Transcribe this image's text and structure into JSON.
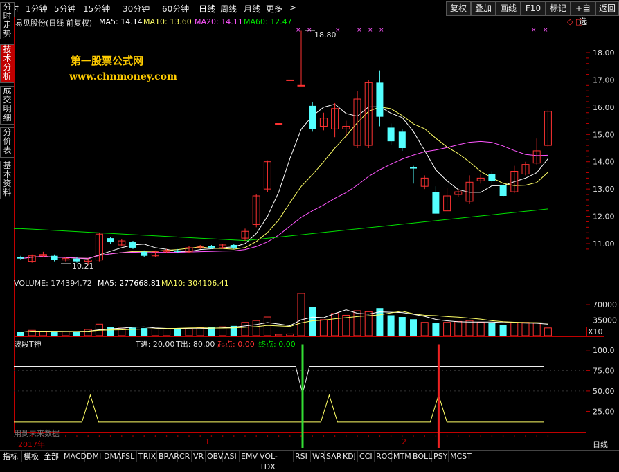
{
  "toolbar": {
    "periods": [
      "分时",
      "1分钟",
      "5分钟",
      "15分钟",
      "30分钟",
      "60分钟",
      "日线",
      "周线",
      "月线",
      "更多"
    ],
    "more_arrow": ">",
    "right_buttons": [
      "复权",
      "叠加",
      "画线",
      "F10",
      "标记",
      "+自选",
      "返回"
    ]
  },
  "side_tabs": [
    "分时走势",
    "技术分析",
    "成交明细",
    "分价表",
    "基本资料"
  ],
  "header": {
    "title": "易见股份(日线 前复权)",
    "ma5": "MA5: 14.14",
    "ma10": "MA10: 13.60",
    "ma20": "MA20: 14.11",
    "ma60": "MA60: 12.47"
  },
  "watermark": {
    "line1": "第一股票公式网",
    "line2": "www.chnmoney.com"
  },
  "price_axis": [
    "18.00",
    "17.00",
    "16.00",
    "15.00",
    "14.00",
    "13.00",
    "12.00",
    "11.00"
  ],
  "annotations": {
    "high": "18.80",
    "low": "10.21"
  },
  "volume_header": {
    "label": "VOLUME: 174394.72",
    "ma5": "MA5: 277668.81",
    "ma10": "MA10: 304106.41"
  },
  "volume_axis": [
    "70000",
    "35000"
  ],
  "volume_unit": "X10",
  "indicator_header": {
    "name": "波段T神",
    "t_in": "T进: 20.00",
    "t_out": "T出: 80.00",
    "start": "起点: 0.00",
    "end": "终点: 0.00"
  },
  "indicator_axis": [
    "100.0",
    "75.00",
    "50.00",
    "25.00"
  ],
  "indicator_note": "用到未来数据",
  "time_axis": {
    "year": "2017年",
    "m1": "1",
    "m2": "2"
  },
  "period_label": "日线",
  "bottom_tabs": [
    "指标",
    "模板",
    "全部",
    "MACD",
    "DMI",
    "DMA",
    "FSL",
    "TRIX",
    "BRAR",
    "CR",
    "VR",
    "OBV",
    "ASI",
    "EMV",
    "VOL-TDX",
    "RSI",
    "WR",
    "SAR",
    "KDJ",
    "CCI",
    "ROC",
    "MTM",
    "BOLL",
    "PSY",
    "MCST"
  ],
  "colors": {
    "up": "#ff3232",
    "down": "#54ffff",
    "ma5": "#ffffff",
    "ma10": "#ffff66",
    "ma20": "#ff55ff",
    "ma60": "#00e000",
    "axis": "#c00000",
    "watermark": "#ffcc00"
  },
  "chart_data": {
    "type": "candlestick",
    "ylim": [
      10.0,
      18.8
    ],
    "candles": [
      {
        "o": 10.5,
        "c": 10.45,
        "h": 10.55,
        "l": 10.4
      },
      {
        "o": 10.35,
        "c": 10.55,
        "h": 10.6,
        "l": 10.3
      },
      {
        "o": 10.55,
        "c": 10.6,
        "h": 10.7,
        "l": 10.5
      },
      {
        "o": 10.55,
        "c": 10.4,
        "h": 10.6,
        "l": 10.35
      },
      {
        "o": 10.4,
        "c": 10.45,
        "h": 10.5,
        "l": 10.35
      },
      {
        "o": 10.45,
        "c": 10.35,
        "h": 10.5,
        "l": 10.3
      },
      {
        "o": 10.35,
        "c": 10.4,
        "h": 10.45,
        "l": 10.21
      },
      {
        "o": 10.4,
        "c": 11.35,
        "h": 11.4,
        "l": 10.35
      },
      {
        "o": 11.2,
        "c": 11.05,
        "h": 11.25,
        "l": 11.0
      },
      {
        "o": 10.95,
        "c": 11.1,
        "h": 11.15,
        "l": 10.9
      },
      {
        "o": 11.05,
        "c": 10.85,
        "h": 11.1,
        "l": 10.8
      },
      {
        "o": 10.7,
        "c": 10.55,
        "h": 10.75,
        "l": 10.5
      },
      {
        "o": 10.55,
        "c": 10.7,
        "h": 10.75,
        "l": 10.5
      },
      {
        "o": 10.7,
        "c": 10.75,
        "h": 10.8,
        "l": 10.65
      },
      {
        "o": 10.75,
        "c": 10.7,
        "h": 10.8,
        "l": 10.65
      },
      {
        "o": 10.7,
        "c": 10.85,
        "h": 10.9,
        "l": 10.65
      },
      {
        "o": 10.85,
        "c": 10.9,
        "h": 10.95,
        "l": 10.8
      },
      {
        "o": 10.9,
        "c": 10.85,
        "h": 10.95,
        "l": 10.8
      },
      {
        "o": 10.85,
        "c": 10.95,
        "h": 11.0,
        "l": 10.8
      },
      {
        "o": 10.95,
        "c": 10.85,
        "h": 11.0,
        "l": 10.8
      },
      {
        "o": 11.2,
        "c": 11.45,
        "h": 11.55,
        "l": 11.1
      },
      {
        "o": 11.7,
        "c": 12.75,
        "h": 12.8,
        "l": 11.6
      },
      {
        "o": 13.0,
        "c": 14.0,
        "h": 14.05,
        "l": 12.9
      },
      {
        "o": 15.4,
        "c": 15.4,
        "h": 15.4,
        "l": 15.4
      },
      {
        "o": 17.0,
        "c": 17.0,
        "h": 17.0,
        "l": 17.0
      },
      {
        "o": 16.8,
        "c": 16.8,
        "h": 18.8,
        "l": 16.8
      },
      {
        "o": 16.05,
        "c": 15.2,
        "h": 16.2,
        "l": 15.1
      },
      {
        "o": 15.3,
        "c": 15.6,
        "h": 15.8,
        "l": 15.15
      },
      {
        "o": 15.2,
        "c": 15.95,
        "h": 16.15,
        "l": 14.9
      },
      {
        "o": 15.2,
        "c": 15.3,
        "h": 15.5,
        "l": 14.9
      },
      {
        "o": 14.6,
        "c": 16.3,
        "h": 16.6,
        "l": 14.5
      },
      {
        "o": 14.6,
        "c": 16.9,
        "h": 17.0,
        "l": 14.5
      },
      {
        "o": 16.9,
        "c": 15.65,
        "h": 17.35,
        "l": 15.3
      },
      {
        "o": 15.25,
        "c": 14.75,
        "h": 15.4,
        "l": 14.6
      },
      {
        "o": 15.1,
        "c": 14.5,
        "h": 15.2,
        "l": 14.4
      },
      {
        "o": 13.8,
        "c": 13.75,
        "h": 13.85,
        "l": 13.2
      },
      {
        "o": 13.1,
        "c": 13.4,
        "h": 13.5,
        "l": 13.0
      },
      {
        "o": 12.9,
        "c": 12.1,
        "h": 13.1,
        "l": 12.1
      },
      {
        "o": 12.2,
        "c": 12.75,
        "h": 13.05,
        "l": 12.2
      },
      {
        "o": 12.8,
        "c": 12.9,
        "h": 13.0,
        "l": 12.7
      },
      {
        "o": 12.55,
        "c": 13.25,
        "h": 13.5,
        "l": 12.45
      },
      {
        "o": 13.3,
        "c": 13.4,
        "h": 13.55,
        "l": 13.2
      },
      {
        "o": 13.55,
        "c": 13.3,
        "h": 13.65,
        "l": 13.2
      },
      {
        "o": 13.15,
        "c": 12.75,
        "h": 13.2,
        "l": 12.7
      },
      {
        "o": 12.9,
        "c": 13.65,
        "h": 13.85,
        "l": 12.85
      },
      {
        "o": 13.55,
        "c": 13.9,
        "h": 14.0,
        "l": 13.5
      },
      {
        "o": 13.95,
        "c": 14.4,
        "h": 14.85,
        "l": 13.9
      },
      {
        "o": 14.6,
        "c": 15.85,
        "h": 15.9,
        "l": 14.55
      }
    ],
    "volume_ylim": [
      0,
      95000
    ],
    "volumes": [
      8000,
      12000,
      10000,
      9000,
      9000,
      8000,
      14000,
      26000,
      20000,
      17000,
      18000,
      17000,
      15000,
      15000,
      15000,
      16000,
      18000,
      20000,
      20000,
      22000,
      30000,
      34000,
      42000,
      3000,
      4000,
      95000,
      64000,
      36000,
      50000,
      46000,
      56000,
      54000,
      62000,
      46000,
      42000,
      37000,
      30000,
      28000,
      30000,
      32000,
      34000,
      30000,
      28000,
      24000,
      30000,
      30000,
      28000,
      17400
    ],
    "indicator_ylim": [
      0,
      110
    ],
    "indicator": {
      "upper_line": 80,
      "lower_line": 0,
      "green_signal_index": 25,
      "red_signal_index": 37
    }
  }
}
